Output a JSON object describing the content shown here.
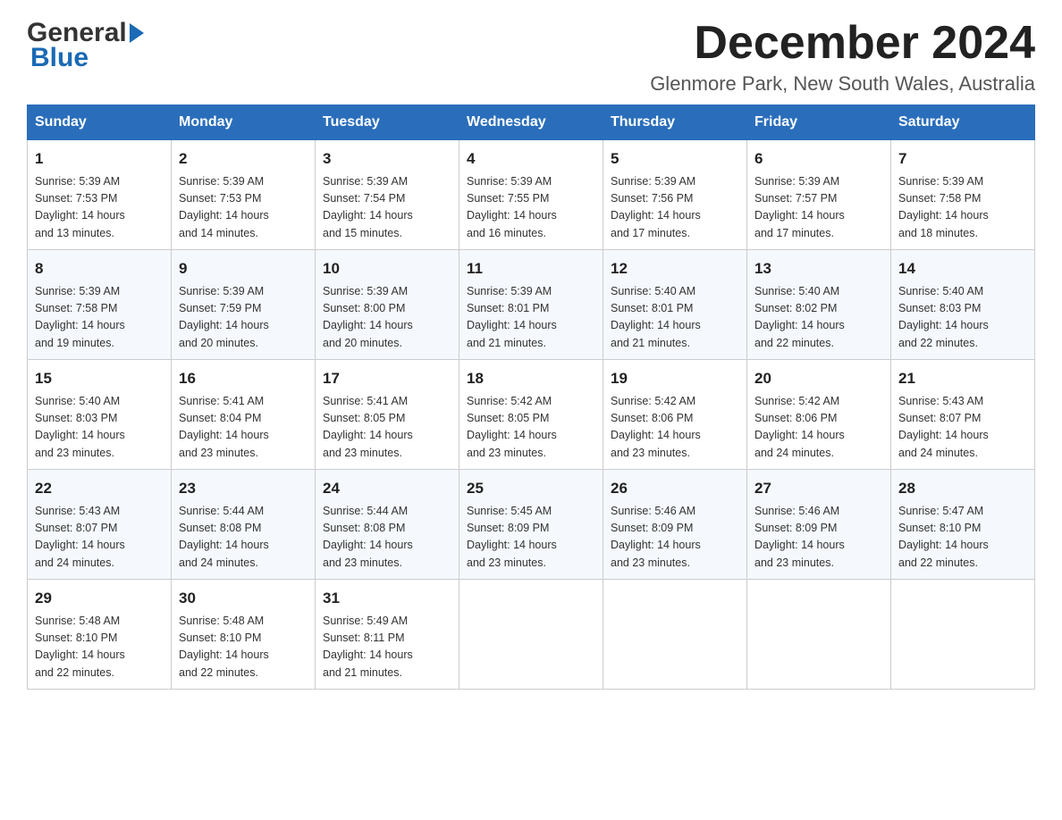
{
  "header": {
    "logo_general": "General",
    "logo_blue": "Blue",
    "month_title": "December 2024",
    "location": "Glenmore Park, New South Wales, Australia"
  },
  "days_of_week": [
    "Sunday",
    "Monday",
    "Tuesday",
    "Wednesday",
    "Thursday",
    "Friday",
    "Saturday"
  ],
  "weeks": [
    [
      {
        "day": "1",
        "sunrise": "5:39 AM",
        "sunset": "7:53 PM",
        "daylight": "14 hours and 13 minutes."
      },
      {
        "day": "2",
        "sunrise": "5:39 AM",
        "sunset": "7:53 PM",
        "daylight": "14 hours and 14 minutes."
      },
      {
        "day": "3",
        "sunrise": "5:39 AM",
        "sunset": "7:54 PM",
        "daylight": "14 hours and 15 minutes."
      },
      {
        "day": "4",
        "sunrise": "5:39 AM",
        "sunset": "7:55 PM",
        "daylight": "14 hours and 16 minutes."
      },
      {
        "day": "5",
        "sunrise": "5:39 AM",
        "sunset": "7:56 PM",
        "daylight": "14 hours and 17 minutes."
      },
      {
        "day": "6",
        "sunrise": "5:39 AM",
        "sunset": "7:57 PM",
        "daylight": "14 hours and 17 minutes."
      },
      {
        "day": "7",
        "sunrise": "5:39 AM",
        "sunset": "7:58 PM",
        "daylight": "14 hours and 18 minutes."
      }
    ],
    [
      {
        "day": "8",
        "sunrise": "5:39 AM",
        "sunset": "7:58 PM",
        "daylight": "14 hours and 19 minutes."
      },
      {
        "day": "9",
        "sunrise": "5:39 AM",
        "sunset": "7:59 PM",
        "daylight": "14 hours and 20 minutes."
      },
      {
        "day": "10",
        "sunrise": "5:39 AM",
        "sunset": "8:00 PM",
        "daylight": "14 hours and 20 minutes."
      },
      {
        "day": "11",
        "sunrise": "5:39 AM",
        "sunset": "8:01 PM",
        "daylight": "14 hours and 21 minutes."
      },
      {
        "day": "12",
        "sunrise": "5:40 AM",
        "sunset": "8:01 PM",
        "daylight": "14 hours and 21 minutes."
      },
      {
        "day": "13",
        "sunrise": "5:40 AM",
        "sunset": "8:02 PM",
        "daylight": "14 hours and 22 minutes."
      },
      {
        "day": "14",
        "sunrise": "5:40 AM",
        "sunset": "8:03 PM",
        "daylight": "14 hours and 22 minutes."
      }
    ],
    [
      {
        "day": "15",
        "sunrise": "5:40 AM",
        "sunset": "8:03 PM",
        "daylight": "14 hours and 23 minutes."
      },
      {
        "day": "16",
        "sunrise": "5:41 AM",
        "sunset": "8:04 PM",
        "daylight": "14 hours and 23 minutes."
      },
      {
        "day": "17",
        "sunrise": "5:41 AM",
        "sunset": "8:05 PM",
        "daylight": "14 hours and 23 minutes."
      },
      {
        "day": "18",
        "sunrise": "5:42 AM",
        "sunset": "8:05 PM",
        "daylight": "14 hours and 23 minutes."
      },
      {
        "day": "19",
        "sunrise": "5:42 AM",
        "sunset": "8:06 PM",
        "daylight": "14 hours and 23 minutes."
      },
      {
        "day": "20",
        "sunrise": "5:42 AM",
        "sunset": "8:06 PM",
        "daylight": "14 hours and 24 minutes."
      },
      {
        "day": "21",
        "sunrise": "5:43 AM",
        "sunset": "8:07 PM",
        "daylight": "14 hours and 24 minutes."
      }
    ],
    [
      {
        "day": "22",
        "sunrise": "5:43 AM",
        "sunset": "8:07 PM",
        "daylight": "14 hours and 24 minutes."
      },
      {
        "day": "23",
        "sunrise": "5:44 AM",
        "sunset": "8:08 PM",
        "daylight": "14 hours and 24 minutes."
      },
      {
        "day": "24",
        "sunrise": "5:44 AM",
        "sunset": "8:08 PM",
        "daylight": "14 hours and 23 minutes."
      },
      {
        "day": "25",
        "sunrise": "5:45 AM",
        "sunset": "8:09 PM",
        "daylight": "14 hours and 23 minutes."
      },
      {
        "day": "26",
        "sunrise": "5:46 AM",
        "sunset": "8:09 PM",
        "daylight": "14 hours and 23 minutes."
      },
      {
        "day": "27",
        "sunrise": "5:46 AM",
        "sunset": "8:09 PM",
        "daylight": "14 hours and 23 minutes."
      },
      {
        "day": "28",
        "sunrise": "5:47 AM",
        "sunset": "8:10 PM",
        "daylight": "14 hours and 22 minutes."
      }
    ],
    [
      {
        "day": "29",
        "sunrise": "5:48 AM",
        "sunset": "8:10 PM",
        "daylight": "14 hours and 22 minutes."
      },
      {
        "day": "30",
        "sunrise": "5:48 AM",
        "sunset": "8:10 PM",
        "daylight": "14 hours and 22 minutes."
      },
      {
        "day": "31",
        "sunrise": "5:49 AM",
        "sunset": "8:11 PM",
        "daylight": "14 hours and 21 minutes."
      },
      null,
      null,
      null,
      null
    ]
  ],
  "labels": {
    "sunrise": "Sunrise:",
    "sunset": "Sunset:",
    "daylight": "Daylight:"
  }
}
